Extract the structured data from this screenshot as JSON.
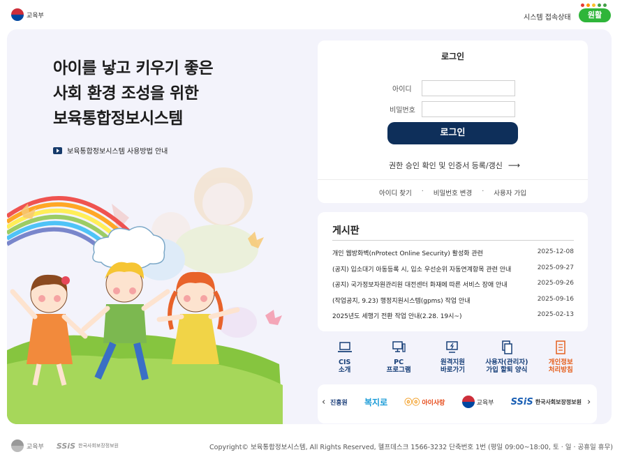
{
  "topbar": {
    "ministry": "교육부",
    "system_status_label": "시스템 접속상태",
    "status_value": "원활",
    "status_color": "#2fb53a",
    "status_dots": [
      "#e53935",
      "#ff9800",
      "#fbc02d",
      "#43a047",
      "#43a047"
    ]
  },
  "hero": {
    "headline": [
      "아이를 낳고 키우기 좋은",
      "사회 환경 조성을 위한",
      "보육통합정보시스템"
    ],
    "guide_link": "보육통합정보시스템 사용방법 안내"
  },
  "login": {
    "title": "로그인",
    "id_label": "아이디",
    "password_label": "비밀번호",
    "id_value": "",
    "password_value": "",
    "submit_label": "로그인",
    "cert_link": "권한 승인 확인 및 인증서 등록/갱신",
    "links": [
      "아이디 찾기",
      "비밀번호 변경",
      "사용자 가입"
    ]
  },
  "board": {
    "title": "게시판",
    "posts": [
      {
        "title": "개인 웹방화벽(nProtect Online Security) 활성화 관련",
        "date": "2025-12-08"
      },
      {
        "title": "(공지) 입소대기 아동등록 시, 입소 우선순위 자동연계항목 관련 안내",
        "date": "2025-09-27"
      },
      {
        "title": "(공지) 국가정보자원관리원 대전센터 화재에 따른 서비스 장애 안내",
        "date": "2025-09-26"
      },
      {
        "title": "(작업공지, 9.23) 행정지원시스템(gpms) 작업 안내",
        "date": "2025-09-16"
      },
      {
        "title": "2025년도 세행기 전환 작업 안내(2.28. 19시~)",
        "date": "2025-02-13"
      }
    ]
  },
  "quick_menu": [
    {
      "line1": "CIS",
      "line2": "소개",
      "icon": "laptop-icon"
    },
    {
      "line1": "PC",
      "line2": "프로그램",
      "icon": "pc-icon"
    },
    {
      "line1": "원격지원",
      "line2": "바로가기",
      "icon": "remote-support-icon"
    },
    {
      "line1": "사용자(관리자)",
      "line2": "가입 할퇴 양식",
      "icon": "document-copy-icon"
    },
    {
      "line1": "개인정보",
      "line2": "처리방침",
      "icon": "privacy-doc-icon",
      "color": "#e5601e"
    }
  ],
  "partners": {
    "prev": "‹",
    "next": "›",
    "logos": [
      "진흥원",
      "복지로",
      "아이사랑",
      "교육부",
      "한국사회보장정보원"
    ],
    "ssis_mark": "SSiS"
  },
  "footer": {
    "ministry": "교육부",
    "ssis_mark": "SSiS",
    "ssis_org": "한국사회보장정보원",
    "copyright": "Copyright© 보육통합정보시스템, All Rights Reserved, 헬프데스크 1566-3232 단축번호 1번 (평일 09:00~18:00, 토 · 일 · 공휴일 휴무)"
  }
}
